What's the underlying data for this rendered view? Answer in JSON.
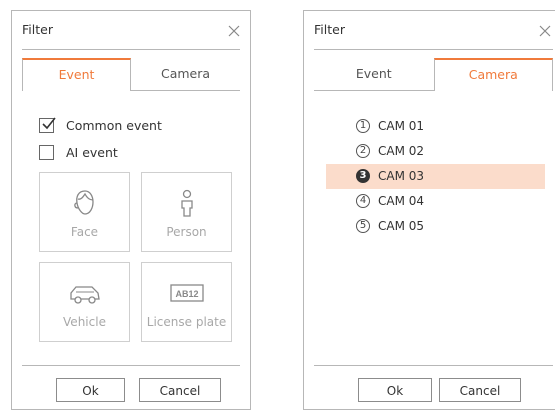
{
  "left_dialog": {
    "title": "Filter",
    "tabs": [
      {
        "label": "Event",
        "active": true
      },
      {
        "label": "Camera",
        "active": false
      }
    ],
    "checkboxes": [
      {
        "label": "Common event",
        "checked": true
      },
      {
        "label": "AI event",
        "checked": false
      }
    ],
    "tiles": [
      {
        "label": "Face",
        "icon": "face-icon"
      },
      {
        "label": "Person",
        "icon": "person-icon"
      },
      {
        "label": "Vehicle",
        "icon": "vehicle-icon"
      },
      {
        "label": "License plate",
        "icon": "license-plate-icon",
        "icon_text": "AB12"
      }
    ],
    "ok_label": "Ok",
    "cancel_label": "Cancel"
  },
  "right_dialog": {
    "title": "Filter",
    "tabs": [
      {
        "label": "Event",
        "active": false
      },
      {
        "label": "Camera",
        "active": true
      }
    ],
    "cameras": [
      {
        "number": "1",
        "label": "CAM 01",
        "selected": false
      },
      {
        "number": "2",
        "label": "CAM 02",
        "selected": false
      },
      {
        "number": "3",
        "label": "CAM 03",
        "selected": true
      },
      {
        "number": "4",
        "label": "CAM 04",
        "selected": false
      },
      {
        "number": "5",
        "label": "CAM 05",
        "selected": false
      }
    ],
    "ok_label": "Ok",
    "cancel_label": "Cancel"
  },
  "colors": {
    "accent": "#f07a3b",
    "selected_row": "#fbdccb",
    "border": "#b7b7b7",
    "disabled_text": "#a8a8a8"
  }
}
